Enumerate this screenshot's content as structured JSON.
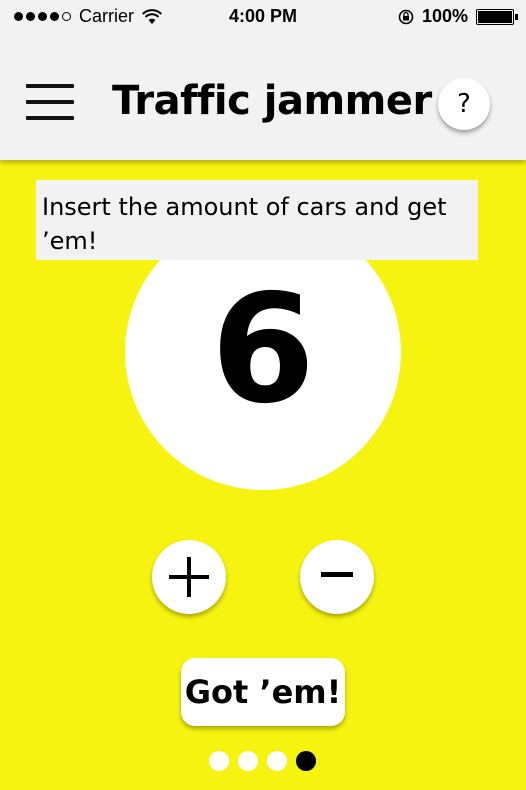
{
  "status_bar": {
    "carrier": "Carrier",
    "time": "4:00 PM",
    "battery_text": "100%"
  },
  "nav": {
    "title": "Traffic jammer",
    "help_label": "?"
  },
  "instruction": "Insert the amount of cars and get ’em!",
  "counter": {
    "value": "6"
  },
  "controls": {
    "increment_icon": "plus-icon",
    "decrement_icon": "minus-icon",
    "submit_label": "Got ’em!"
  },
  "pager": {
    "total": 4,
    "active_index": 3
  },
  "colors": {
    "background": "#f5f30f",
    "bar": "#f2f2f2",
    "button": "#ffffff",
    "text": "#000000"
  }
}
